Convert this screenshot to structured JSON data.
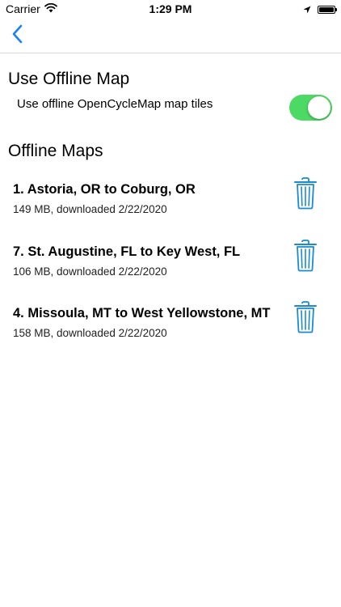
{
  "status_bar": {
    "carrier": "Carrier",
    "time": "1:29 PM",
    "icons": [
      "wifi-icon",
      "location-arrow-icon",
      "battery-icon"
    ]
  },
  "nav": {
    "back_icon": "chevron-left-icon",
    "accent_color": "#1a82f7"
  },
  "offline_setting": {
    "title": "Use Offline Map",
    "toggle_label": "Use offline OpenCycleMap map tiles",
    "toggle_on": true,
    "toggle_color": "#4cd964"
  },
  "offline_maps": {
    "title": "Offline Maps",
    "delete_icon": "trash-icon",
    "delete_icon_color": "#1a8bd0",
    "items": [
      {
        "title": "1. Astoria, OR to Coburg, OR",
        "subtitle": "149 MB, downloaded 2/22/2020"
      },
      {
        "title": "7. St. Augustine, FL to Key West, FL",
        "subtitle": "106 MB, downloaded 2/22/2020"
      },
      {
        "title": "4. Missoula, MT to West Yellowstone, MT",
        "subtitle": "158 MB, downloaded 2/22/2020"
      }
    ]
  }
}
